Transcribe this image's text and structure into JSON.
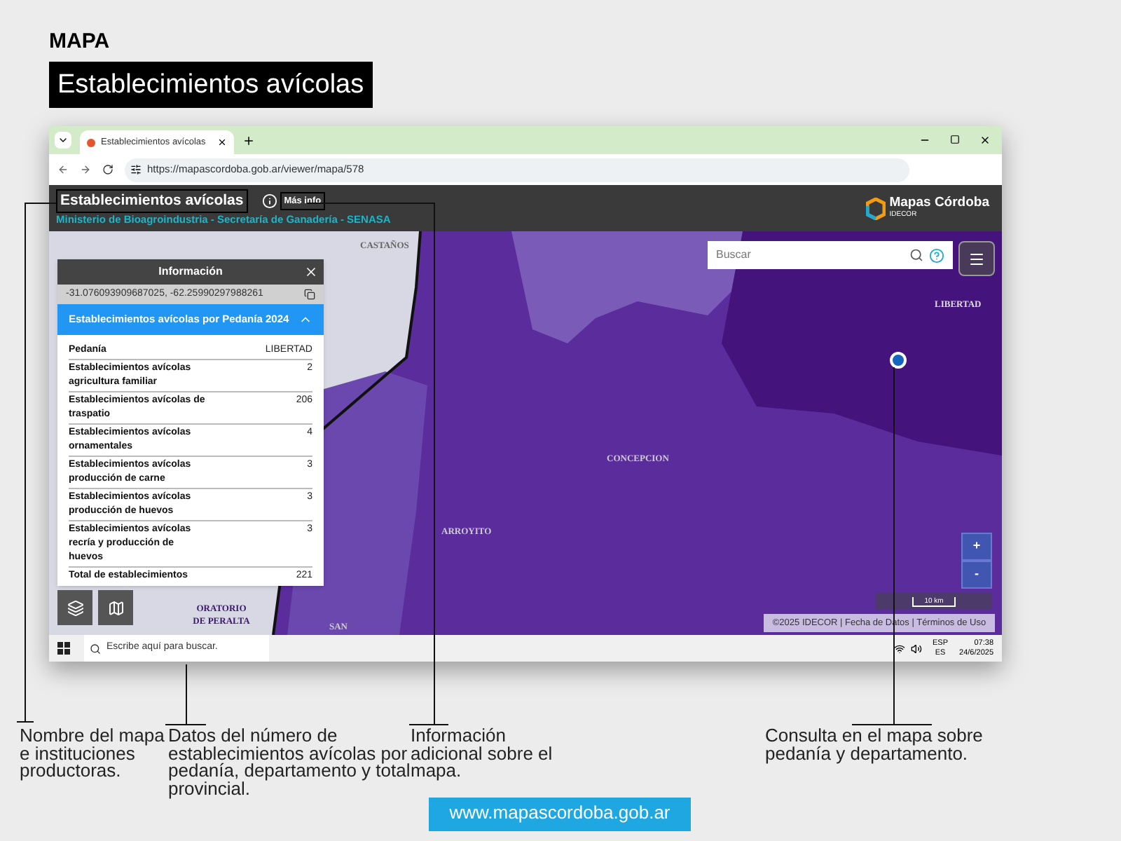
{
  "header": {
    "section": "MAPA",
    "title": "Establecimientos avícolas"
  },
  "browser": {
    "tab_title": "Establecimientos avícolas",
    "url": "https://mapascordoba.gob.ar/viewer/mapa/578"
  },
  "app": {
    "title": "Establecimientos avícolas",
    "more_info": "Más info",
    "subtitle": "Ministerio de Bioagroindustria - Secretaría de Ganadería - SENASA",
    "logo_name": "Mapas Córdoba",
    "logo_sub": "IDECOR"
  },
  "map": {
    "labels": [
      "CASTAÑOS",
      "LIBERTAD",
      "CONCEPCION",
      "ARROYITO",
      "ORATORIO DE PERALTA",
      "SAN"
    ],
    "search": {
      "placeholder": "Buscar"
    },
    "zoom": [
      "+",
      "-"
    ],
    "scale": "10 km",
    "attribution": "©2025 IDECOR | Fecha de Datos | Términos de Uso"
  },
  "info_panel": {
    "title": "Información",
    "coords": "-31.076093909687025, -62.25990297988261",
    "section": {
      "title": "Establecimientos avícolas por Pedanía 2024",
      "expanded": true
    },
    "rows": [
      {
        "label": "Pedanía",
        "value": "LIBERTAD"
      },
      {
        "label": "Establecimientos avícolas agricultura familiar",
        "value": "2"
      },
      {
        "label": "Establecimientos avícolas de traspatio",
        "value": "206"
      },
      {
        "label": "Establecimientos avícolas ornamentales",
        "value": "4"
      },
      {
        "label": "Establecimientos avícolas producción de carne",
        "value": "3"
      },
      {
        "label": "Establecimientos avícolas producción de huevos",
        "value": "3"
      },
      {
        "label": "Establecimientos avícolas recría y producción de huevos",
        "value": "3"
      },
      {
        "label": "Total de establecimientos",
        "value": "221"
      }
    ]
  },
  "taskbar": {
    "search_placeholder": "Escribe aquí para buscar.",
    "lang": "ESP",
    "layout": "ES",
    "time": "07:38",
    "date": "24/6/2025"
  },
  "annotations": [
    "Nombre del mapa e instituciones productoras.",
    "Datos del número de establecimientos avícolas por pedanía, departamento y total provincial.",
    "Información adicional sobre el mapa.",
    "Consulta en el mapa sobre pedanía y departamento."
  ],
  "footer_url": "www.mapascordoba.gob.ar"
}
